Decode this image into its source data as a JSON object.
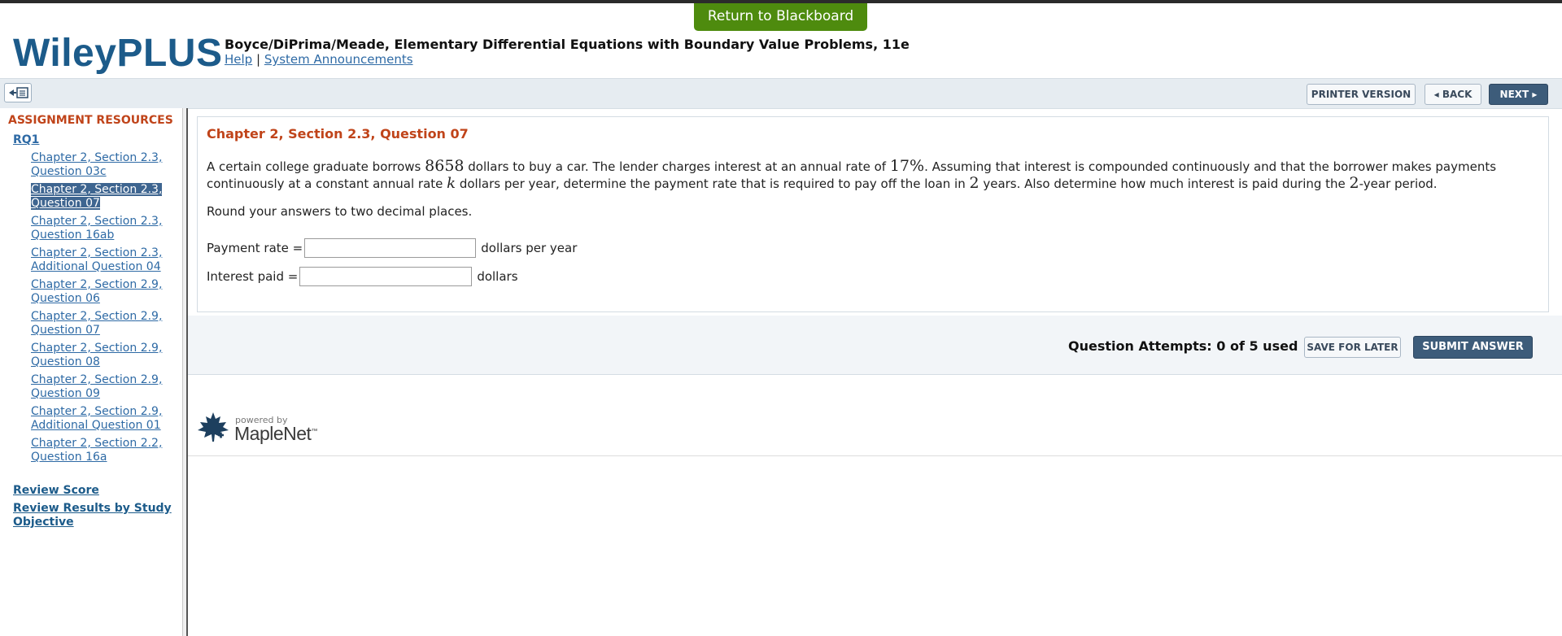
{
  "header": {
    "return_label": "Return to Blackboard",
    "logo": "WileyPLUS",
    "book_title": "Boyce/DiPrima/Meade, Elementary Differential Equations with Boundary Value Problems, 11e",
    "help_label": "Help",
    "separator": "|",
    "announcements_label": "System Announcements"
  },
  "toolbar": {
    "printer_label": "PRINTER VERSION",
    "back_label": "BACK",
    "next_label": "NEXT"
  },
  "sidebar": {
    "heading": "ASSIGNMENT RESOURCES",
    "group": "RQ1",
    "items": [
      {
        "line1": "Chapter 2, Section 2.3,",
        "line2": "Question 03c",
        "active": false
      },
      {
        "line1": "Chapter 2, Section 2.3,",
        "line2": "Question 07",
        "active": true
      },
      {
        "line1": "Chapter 2, Section 2.3,",
        "line2": "Question 16ab",
        "active": false
      },
      {
        "line1": "Chapter 2, Section 2.3,",
        "line2": "Additional Question 04",
        "active": false
      },
      {
        "line1": "Chapter 2, Section 2.9,",
        "line2": "Question 06",
        "active": false
      },
      {
        "line1": "Chapter 2, Section 2.9,",
        "line2": "Question 07",
        "active": false
      },
      {
        "line1": "Chapter 2, Section 2.9,",
        "line2": "Question 08",
        "active": false
      },
      {
        "line1": "Chapter 2, Section 2.9,",
        "line2": "Question 09",
        "active": false
      },
      {
        "line1": "Chapter 2, Section 2.9,",
        "line2": "Additional Question 01",
        "active": false
      },
      {
        "line1": "Chapter 2, Section 2.2,",
        "line2": "Question 16a",
        "active": false
      }
    ],
    "review_score": "Review Score",
    "review_results_line1": "Review Results by Study",
    "review_results_line2": "Objective"
  },
  "question": {
    "title": "Chapter 2, Section 2.3, Question 07",
    "t1": "A certain college graduate borrows ",
    "amount": "8658",
    "t2": " dollars to buy a car. The lender charges interest at an annual rate of ",
    "rate": "17%",
    "t3": ". Assuming that interest is compounded continuously and that the borrower makes payments continuously at a constant annual rate ",
    "var": "k",
    "t4": " dollars per year, determine the payment rate that is required to pay off the loan in ",
    "years": "2",
    "t5": " years. Also determine how much interest is paid during the ",
    "years2": "2",
    "t6": "-year period.",
    "round_note": "Round your answers to two decimal places.",
    "payment_label": "Payment rate =",
    "payment_value": "",
    "payment_unit": "dollars per year",
    "interest_label": "Interest paid =",
    "interest_value": "",
    "interest_unit": "dollars"
  },
  "attempts": {
    "text": "Question Attempts: 0 of 5 used",
    "save_label": "SAVE FOR LATER",
    "submit_label": "SUBMIT ANSWER"
  },
  "footer": {
    "powered_by": "powered by",
    "brand": "MapleNet",
    "tm": "™"
  },
  "colors": {
    "brand_blue": "#1c5b8a",
    "accent_orange": "#c0441a",
    "return_green": "#4e8b0e",
    "active_item": "#3e6590"
  }
}
